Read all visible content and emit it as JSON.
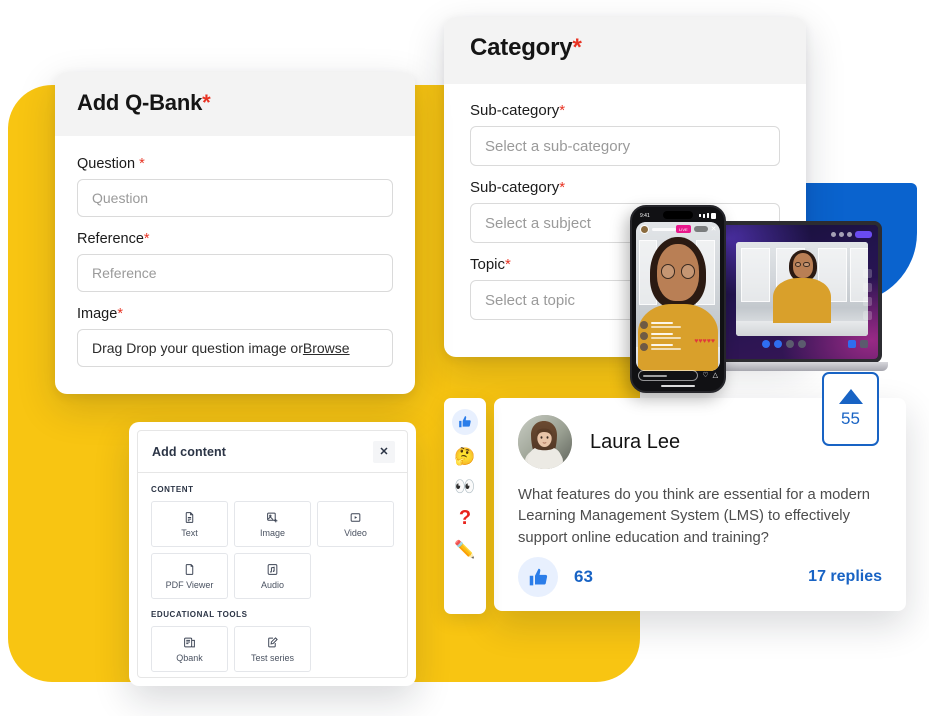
{
  "qbank_card": {
    "title": "Add Q-Bank",
    "required_mark": "*",
    "fields": [
      {
        "label": "Question ",
        "required": "*",
        "placeholder": "Question",
        "value": ""
      },
      {
        "label": "Reference",
        "required": "*",
        "placeholder": "Reference",
        "value": ""
      },
      {
        "label": "Image",
        "required": "*",
        "dropzone_text": "Drag Drop your question image or ",
        "browse_label": "Browse"
      }
    ]
  },
  "category_card": {
    "title": "Category",
    "required_mark": "*",
    "fields": [
      {
        "label": "Sub-category",
        "required": "*",
        "placeholder": "Select a sub-category",
        "value": ""
      },
      {
        "label": "Sub-category",
        "required": "*",
        "placeholder": "Select a subject",
        "value": ""
      },
      {
        "label": "Topic",
        "required": "*",
        "placeholder": "Select a topic",
        "value": ""
      }
    ]
  },
  "add_content": {
    "title": "Add content",
    "close_label": "✕",
    "sections": [
      {
        "label": "CONTENT",
        "tiles": [
          {
            "label": "Text",
            "icon": "document-text-icon"
          },
          {
            "label": "Image",
            "icon": "image-add-icon"
          },
          {
            "label": "Video",
            "icon": "video-play-icon"
          },
          {
            "label": "PDF Viewer",
            "icon": "pdf-file-icon"
          },
          {
            "label": "Audio",
            "icon": "audio-note-icon"
          }
        ]
      },
      {
        "label": "EDUCATIONAL TOOLS",
        "tiles": [
          {
            "label": "Qbank",
            "icon": "question-bank-icon"
          },
          {
            "label": "Test series",
            "icon": "test-edit-icon"
          }
        ]
      }
    ]
  },
  "reactions": [
    {
      "name": "thumbs-up-reaction",
      "glyph": ""
    },
    {
      "name": "thinking-face-reaction",
      "glyph": "🤔"
    },
    {
      "name": "eyes-reaction",
      "glyph": "👀"
    },
    {
      "name": "question-mark-reaction",
      "glyph": "?"
    },
    {
      "name": "pencil-reaction",
      "glyph": "✏️"
    }
  ],
  "discussion": {
    "author": "Laura Lee",
    "message": "What features do you think are essential for a modern Learning Management System (LMS) to effectively support online education and training?",
    "like_count": "63",
    "replies_label": "17 replies"
  },
  "upvote": {
    "count": "55",
    "icon": "upvote-triangle-icon"
  },
  "devices": {
    "phone": {
      "status_time": "9:41",
      "live_badge": "LIVE",
      "close_glyph": "✕",
      "hearts": "♥♥♥♥♥"
    }
  },
  "colors": {
    "brand_yellow": "#F8C512",
    "brand_blue": "#0A63CE",
    "accent_blue": "#1863C4",
    "required_red": "#E83323",
    "card_header_grey": "#F3F3F3"
  }
}
